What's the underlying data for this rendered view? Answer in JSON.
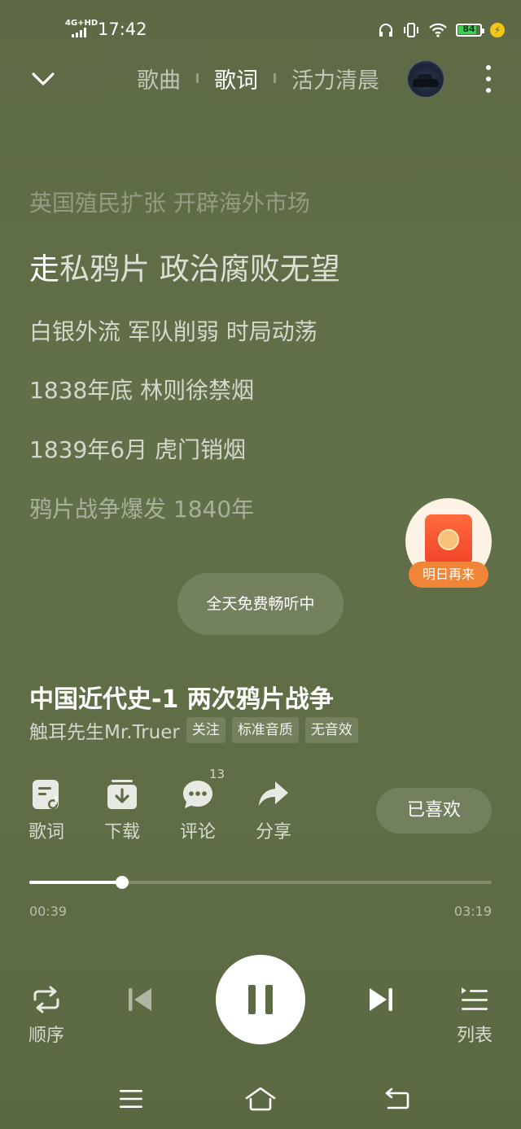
{
  "status_bar": {
    "network": "4G+HD",
    "time": "17:42",
    "battery": "84"
  },
  "header": {
    "tabs": [
      {
        "label": "歌曲",
        "active": false
      },
      {
        "label": "歌词",
        "active": true
      },
      {
        "label": "活力清晨",
        "active": false
      }
    ]
  },
  "lyrics": {
    "lines": [
      "英国殖民扩张  开辟海外市场",
      "走私鸦片  政治腐败无望",
      "白银外流  军队削弱  时局动荡",
      "1838年底  林则徐禁烟",
      "1839年6月  虎门销烟",
      "鸦片战争爆发  1840年"
    ],
    "current_highlight": "走",
    "current_rest": "私鸦片  政治腐败无望"
  },
  "promo": {
    "red_packet_label": "明日再来",
    "free_listening": "全天免费畅听中"
  },
  "song": {
    "title": "中国近代史-1  两次鸦片战争",
    "artist": "触耳先生Mr.Truer",
    "chips": [
      "关注",
      "标准音质",
      "无音效"
    ]
  },
  "actions": {
    "lyrics": "歌词",
    "download": "下载",
    "comments": "评论",
    "comment_count": "13",
    "share": "分享",
    "liked": "已喜欢"
  },
  "progress": {
    "current": "00:39",
    "total": "03:19",
    "fraction": 0.2
  },
  "controls": {
    "mode": "顺序",
    "playlist": "列表"
  },
  "colors": {
    "background": "#5f6d46",
    "accent_orange": "#f08537",
    "battery_green": "#39d353"
  }
}
